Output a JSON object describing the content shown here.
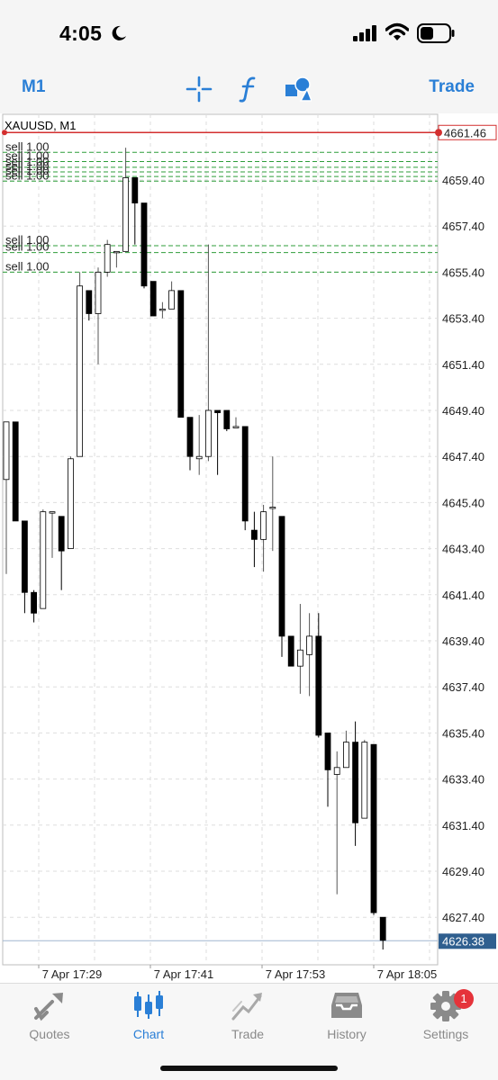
{
  "status_bar": {
    "time": "4:05"
  },
  "toolbar": {
    "timeframe_label": "M1",
    "trade_label": "Trade"
  },
  "chart": {
    "symbol_label": "XAUUSD, M1",
    "sell_order_label": "sell 1.00",
    "current_price_label": "4626.38",
    "top_line_label": "4661.46",
    "colors": {
      "accent": "#2a7fd6",
      "top_line": "#d32f2f",
      "order_line": "#2e9d3a",
      "current_badge": "#2f5f8f"
    },
    "price_ticks": [
      "4659.40",
      "4657.40",
      "4655.40",
      "4653.40",
      "4651.40",
      "4649.40",
      "4647.40",
      "4645.40",
      "4643.40",
      "4641.40",
      "4639.40",
      "4637.40",
      "4635.40",
      "4633.40",
      "4631.40",
      "4629.40",
      "4627.40"
    ],
    "time_ticks": [
      "7 Apr 17:29",
      "7 Apr 17:41",
      "7 Apr 17:53",
      "7 Apr 18:05"
    ]
  },
  "chart_data": {
    "type": "candlestick",
    "title": "XAUUSD, M1",
    "ylim": [
      4625.0,
      4662.5
    ],
    "grid": true,
    "current_price": 4626.38,
    "top_level": 4661.46,
    "sell_levels": [
      4660.6,
      4660.2,
      4659.95,
      4659.75,
      4659.55,
      4659.35,
      4656.55,
      4656.25,
      4655.4
    ],
    "candles": [
      {
        "o": 4646.4,
        "h": 4648.9,
        "l": 4642.3,
        "c": 4648.9
      },
      {
        "o": 4648.9,
        "h": 4648.9,
        "l": 4644.6,
        "c": 4644.6
      },
      {
        "o": 4644.6,
        "h": 4644.6,
        "l": 4640.6,
        "c": 4641.5
      },
      {
        "o": 4641.5,
        "h": 4641.6,
        "l": 4640.2,
        "c": 4640.6
      },
      {
        "o": 4640.8,
        "h": 4645.1,
        "l": 4640.8,
        "c": 4645.0
      },
      {
        "o": 4645.0,
        "h": 4645.0,
        "l": 4643.0,
        "c": 4645.0
      },
      {
        "o": 4644.8,
        "h": 4644.8,
        "l": 4641.6,
        "c": 4643.3
      },
      {
        "o": 4643.4,
        "h": 4647.4,
        "l": 4643.4,
        "c": 4647.3
      },
      {
        "o": 4647.4,
        "h": 4655.4,
        "l": 4647.4,
        "c": 4654.8
      },
      {
        "o": 4654.6,
        "h": 4654.6,
        "l": 4653.3,
        "c": 4653.6
      },
      {
        "o": 4653.6,
        "h": 4655.6,
        "l": 4651.4,
        "c": 4655.4
      },
      {
        "o": 4655.4,
        "h": 4656.8,
        "l": 4655.2,
        "c": 4656.6
      },
      {
        "o": 4656.3,
        "h": 4656.3,
        "l": 4655.6,
        "c": 4656.3
      },
      {
        "o": 4656.3,
        "h": 4660.8,
        "l": 4656.3,
        "c": 4659.5
      },
      {
        "o": 4659.5,
        "h": 4659.5,
        "l": 4656.6,
        "c": 4658.4
      },
      {
        "o": 4658.4,
        "h": 4658.4,
        "l": 4654.7,
        "c": 4654.8
      },
      {
        "o": 4655.0,
        "h": 4655.0,
        "l": 4653.5,
        "c": 4653.5
      },
      {
        "o": 4653.8,
        "h": 4654.1,
        "l": 4653.4,
        "c": 4653.8
      },
      {
        "o": 4653.8,
        "h": 4655.0,
        "l": 4653.8,
        "c": 4654.6
      },
      {
        "o": 4654.6,
        "h": 4654.6,
        "l": 4649.1,
        "c": 4649.1
      },
      {
        "o": 4649.1,
        "h": 4649.1,
        "l": 4646.8,
        "c": 4647.4
      },
      {
        "o": 4647.3,
        "h": 4649.2,
        "l": 4646.6,
        "c": 4647.4
      },
      {
        "o": 4647.4,
        "h": 4656.6,
        "l": 4647.2,
        "c": 4649.4
      },
      {
        "o": 4649.4,
        "h": 4649.4,
        "l": 4646.6,
        "c": 4649.3
      },
      {
        "o": 4649.4,
        "h": 4649.4,
        "l": 4648.5,
        "c": 4648.6
      },
      {
        "o": 4648.7,
        "h": 4649.1,
        "l": 4648.7,
        "c": 4648.7
      },
      {
        "o": 4648.7,
        "h": 4648.7,
        "l": 4644.2,
        "c": 4644.6
      },
      {
        "o": 4644.2,
        "h": 4645.0,
        "l": 4642.6,
        "c": 4643.8
      },
      {
        "o": 4643.8,
        "h": 4645.3,
        "l": 4642.4,
        "c": 4645.0
      },
      {
        "o": 4645.2,
        "h": 4647.4,
        "l": 4643.3,
        "c": 4645.2
      },
      {
        "o": 4644.8,
        "h": 4644.8,
        "l": 4638.7,
        "c": 4639.6
      },
      {
        "o": 4639.6,
        "h": 4639.6,
        "l": 4638.3,
        "c": 4638.3
      },
      {
        "o": 4638.3,
        "h": 4641.0,
        "l": 4637.1,
        "c": 4639.0
      },
      {
        "o": 4638.8,
        "h": 4640.6,
        "l": 4637.0,
        "c": 4639.6
      },
      {
        "o": 4639.6,
        "h": 4640.6,
        "l": 4635.2,
        "c": 4635.3
      },
      {
        "o": 4635.4,
        "h": 4635.4,
        "l": 4632.2,
        "c": 4633.8
      },
      {
        "o": 4633.6,
        "h": 4634.6,
        "l": 4628.4,
        "c": 4633.9
      },
      {
        "o": 4633.9,
        "h": 4635.5,
        "l": 4633.9,
        "c": 4635.0
      },
      {
        "o": 4635.0,
        "h": 4635.9,
        "l": 4630.5,
        "c": 4631.5
      },
      {
        "o": 4631.7,
        "h": 4635.1,
        "l": 4631.7,
        "c": 4635.0
      },
      {
        "o": 4634.9,
        "h": 4634.9,
        "l": 4627.5,
        "c": 4627.6
      },
      {
        "o": 4627.4,
        "h": 4627.4,
        "l": 4626.0,
        "c": 4626.4
      }
    ]
  },
  "tabs": [
    {
      "label": "Quotes"
    },
    {
      "label": "Chart"
    },
    {
      "label": "Trade"
    },
    {
      "label": "History"
    },
    {
      "label": "Settings",
      "badge": "1"
    }
  ]
}
